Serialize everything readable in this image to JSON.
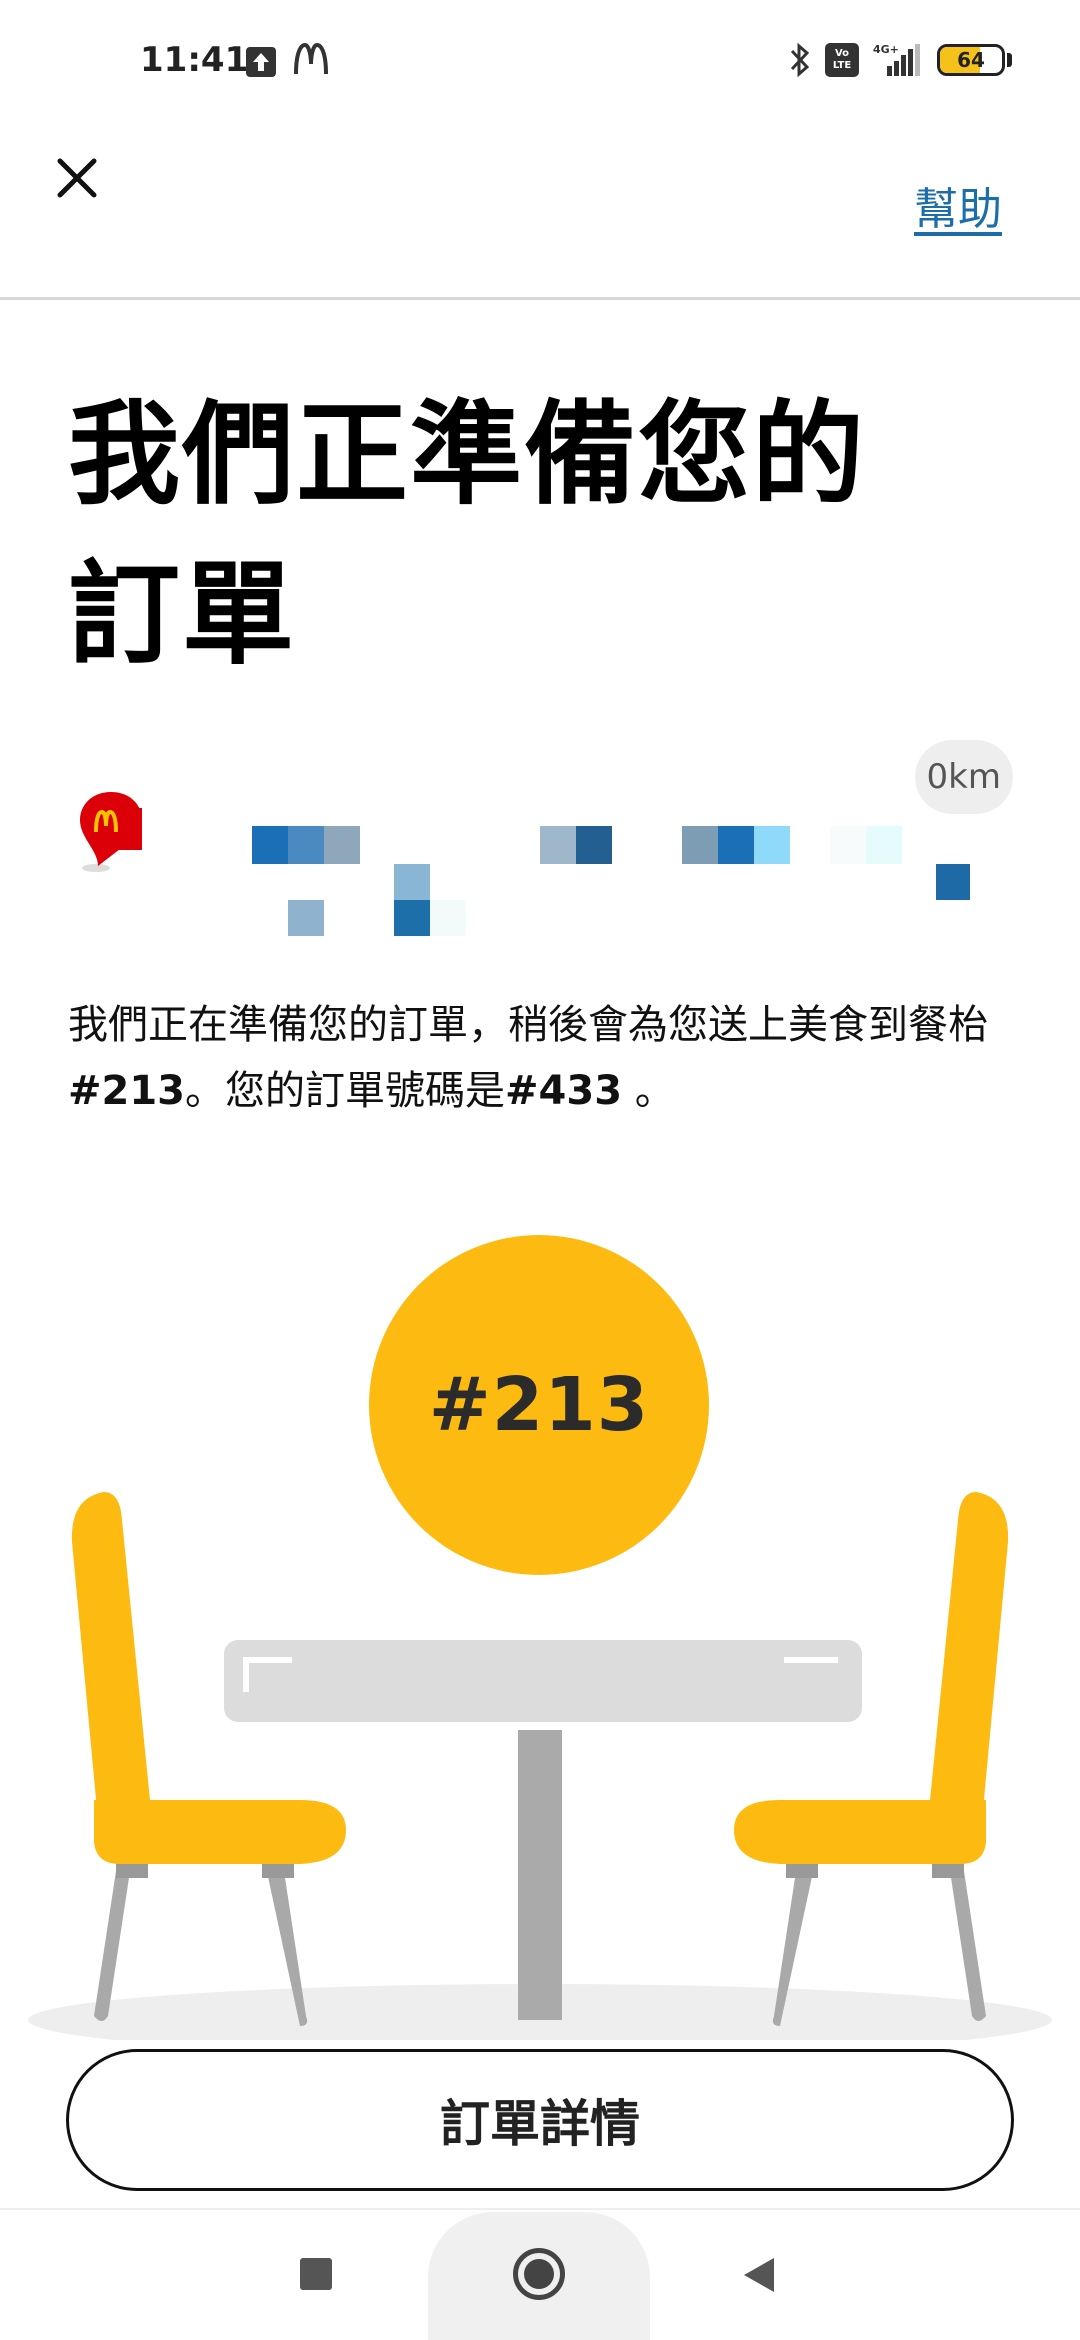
{
  "status_bar": {
    "time": "11:41",
    "network": "4G+",
    "volte_top": "Vo",
    "volte_bottom": "LTE",
    "battery_level": "64",
    "battery_fraction": 0.64
  },
  "header": {
    "close_icon": "close-icon",
    "help_label": "幫助"
  },
  "title": "我們正準備您的訂單",
  "location": {
    "distance": "0km",
    "pin_icon": "mcdonalds-pin-icon"
  },
  "description": {
    "part1": "我們正在準備您的訂單，稍後會為您送上美食到餐枱",
    "table_number": "#213",
    "part2": "。您的訂單號碼是",
    "order_number": "#433",
    "part3": " 。"
  },
  "illustration": {
    "table_badge": "#213",
    "colors": {
      "accent": "#fdbb12",
      "table": "#dcdcdc",
      "legs": "#a8a8a8"
    }
  },
  "actions": {
    "order_details_label": "訂單詳情"
  },
  "nav": {
    "recents_icon": "square-icon",
    "home_icon": "circle-icon",
    "back_icon": "triangle-back-icon"
  }
}
